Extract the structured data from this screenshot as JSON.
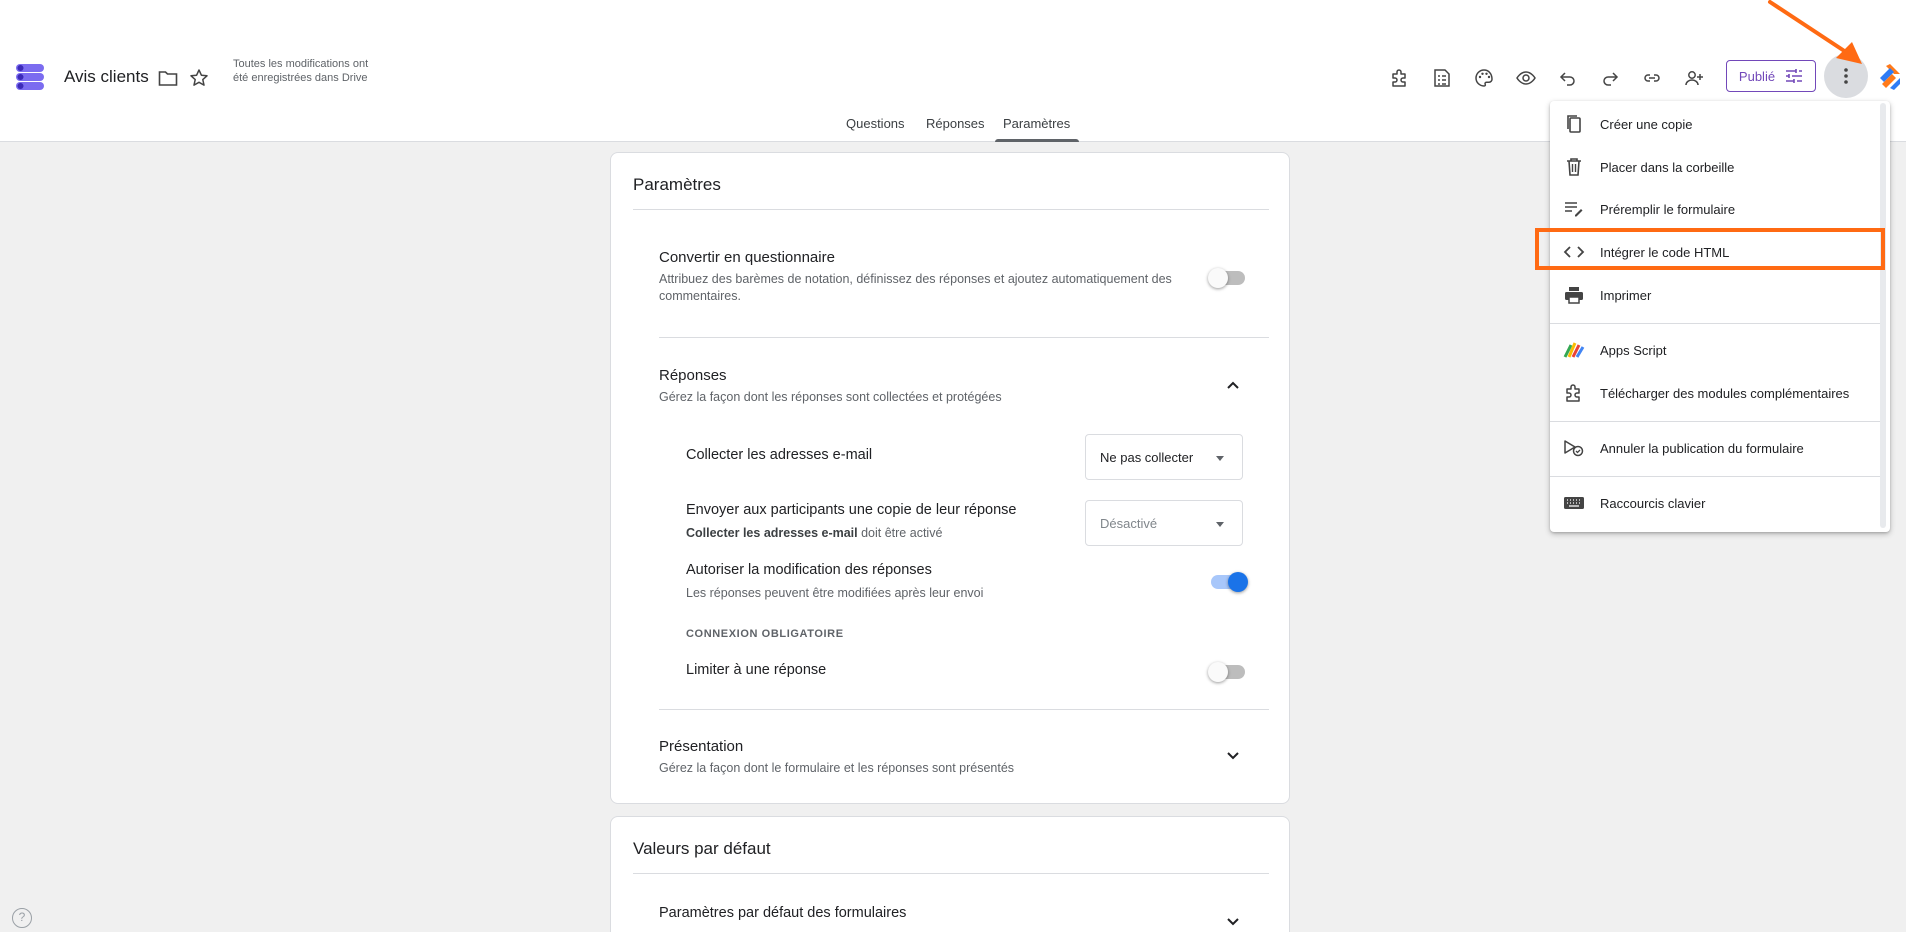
{
  "header": {
    "title": "Avis clients",
    "save_status": "Toutes les modifications ont été enregistrées dans Drive",
    "publish_label": "Publié"
  },
  "tabs": [
    {
      "label": "Questions"
    },
    {
      "label": "Réponses"
    },
    {
      "label": "Paramètres",
      "active": true
    }
  ],
  "settings": {
    "title": "Paramètres",
    "quiz": {
      "title": "Convertir en questionnaire",
      "desc": "Attribuez des barèmes de notation, définissez des réponses et ajoutez automatiquement des commentaires.",
      "enabled": false
    },
    "responses": {
      "title": "Réponses",
      "desc": "Gérez la façon dont les réponses sont collectées et protégées",
      "collect_email": {
        "label": "Collecter les adresses e-mail",
        "value": "Ne pas collecter"
      },
      "send_copy": {
        "label": "Envoyer aux participants une copie de leur réponse",
        "hint_bold": "Collecter les adresses e-mail",
        "hint_rest": " doit être activé",
        "value": "Désactivé"
      },
      "allow_edit": {
        "label": "Autoriser la modification des réponses",
        "desc": "Les réponses peuvent être modifiées après leur envoi",
        "enabled": true
      },
      "login_section": "CONNEXION OBLIGATOIRE",
      "limit_one": {
        "label": "Limiter à une réponse",
        "enabled": false
      }
    },
    "presentation": {
      "title": "Présentation",
      "desc": "Gérez la façon dont le formulaire et les réponses sont présentés"
    }
  },
  "defaults": {
    "title": "Valeurs par défaut",
    "form_defaults": {
      "title": "Paramètres par défaut des formulaires"
    }
  },
  "menu": {
    "items": [
      {
        "label": "Créer une copie",
        "icon": "copy-icon"
      },
      {
        "label": "Placer dans la corbeille",
        "icon": "trash-icon"
      },
      {
        "label": "Préremplir le formulaire",
        "icon": "prefill-icon"
      },
      {
        "label": "Intégrer le code HTML",
        "icon": "code-icon"
      },
      {
        "label": "Imprimer",
        "icon": "print-icon"
      },
      {
        "label": "Apps Script",
        "icon": "apps-script-icon"
      },
      {
        "label": "Télécharger des modules complémentaires",
        "icon": "puzzle-icon"
      },
      {
        "label": "Annuler la publication du formulaire",
        "icon": "unpublish-icon"
      },
      {
        "label": "Raccourcis clavier",
        "icon": "keyboard-icon"
      }
    ]
  },
  "help_glyph": "?",
  "colors": {
    "accent": "#7248b9",
    "highlight": "#ff6a13",
    "toggle_on": "#1a73e8"
  }
}
